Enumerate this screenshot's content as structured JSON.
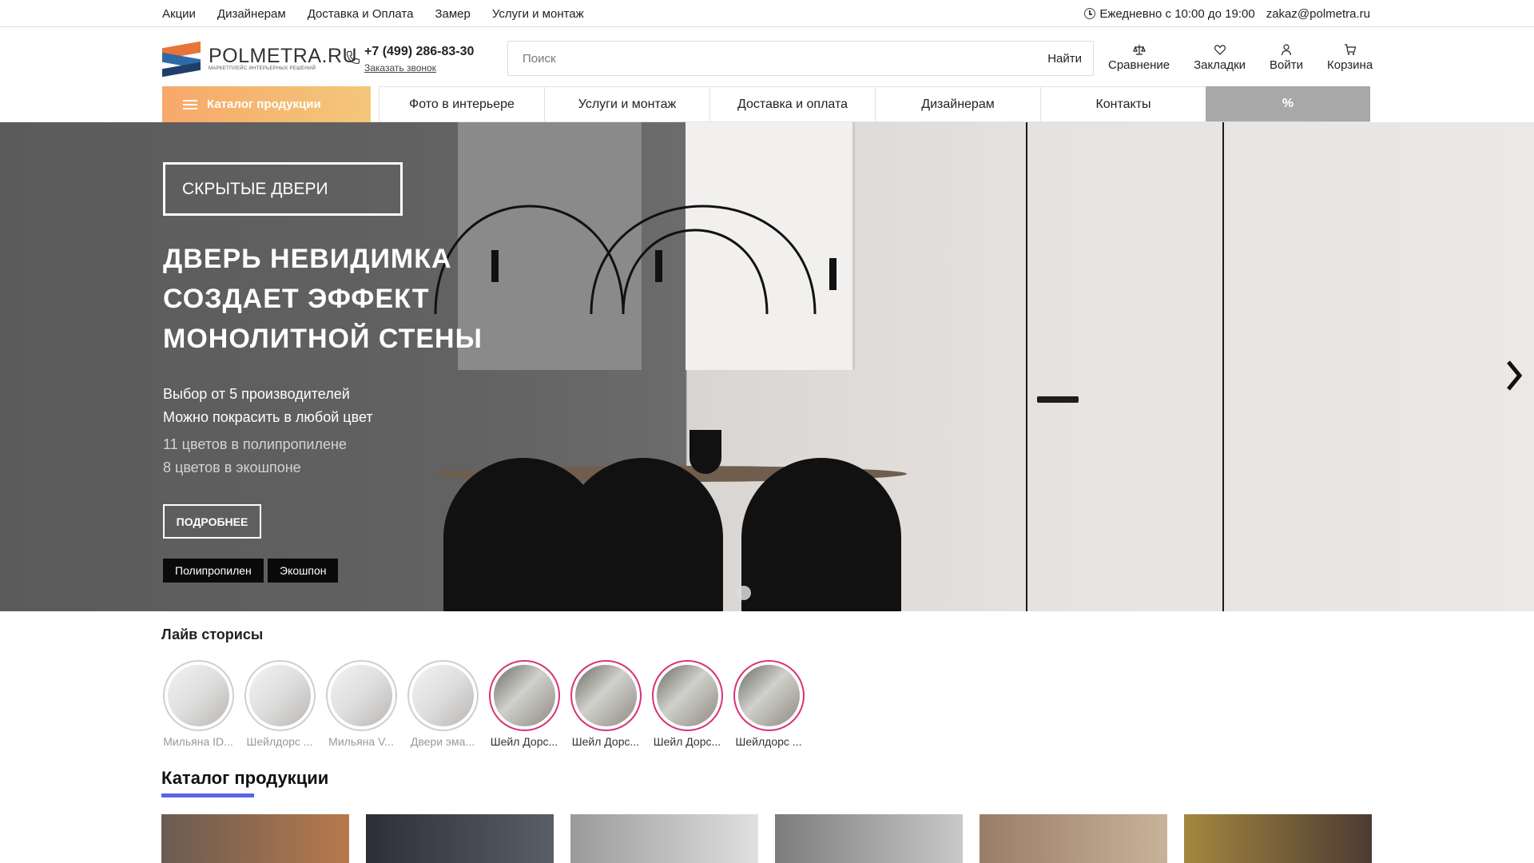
{
  "topbar": {
    "links": [
      "Акции",
      "Дизайнерам",
      "Доставка и Оплата",
      "Замер",
      "Услуги и монтаж"
    ],
    "hours": "Ежедневно с 10:00 до 19:00",
    "email": "zakaz@polmetra.ru"
  },
  "header": {
    "logo_name": "POLMETRA.RU",
    "logo_sub": "МАРКЕТПЛЕЙС ИНТЕРЬЕРНЫХ РЕШЕНИЙ",
    "phone": "+7 (499) 286-83-30",
    "callback": "Заказать звонок",
    "search_placeholder": "Поиск",
    "search_button": "Найти",
    "actions": {
      "compare": "Сравнение",
      "bookmarks": "Закладки",
      "login": "Войти",
      "cart": "Корзина"
    }
  },
  "nav": {
    "catalog": "Каталог продукции",
    "items": [
      "Фото в интерьере",
      "Услуги и монтаж",
      "Доставка и оплата",
      "Дизайнерам",
      "Контакты"
    ],
    "promo": "%"
  },
  "hero": {
    "tag": "СКРЫТЫЕ ДВЕРИ",
    "title_lines": [
      "ДВЕРЬ НЕВИДИМКА",
      "СОЗДАЕТ ЭФФЕКТ",
      "МОНОЛИТНОЙ СТЕНЫ"
    ],
    "line1": "Выбор от 5 производителей",
    "line2": "Можно покрасить в любой цвет",
    "line3": "11 цветов в полипропилене",
    "line4": "8 цветов в экошпоне",
    "more_button": "ПОДРОБНЕЕ",
    "chips": [
      "Полипропилен",
      "Экошпон"
    ]
  },
  "stories": {
    "title": "Лайв сторисы",
    "items": [
      {
        "label": "Мильяна ID..."
      },
      {
        "label": "Шейлдорс ..."
      },
      {
        "label": "Мильяна V..."
      },
      {
        "label": "Двери эма..."
      },
      {
        "label": "Шейл Дорс..."
      },
      {
        "label": "Шейл Дорс..."
      },
      {
        "label": "Шейл Дорс..."
      },
      {
        "label": "Шейлдорс ..."
      }
    ]
  },
  "catalog": {
    "title": "Каталог продукции"
  },
  "colors": {
    "accent_underline": "#5b63e6",
    "catalog_button": "#f7a86a",
    "story_ring_active": "#d6337a"
  }
}
